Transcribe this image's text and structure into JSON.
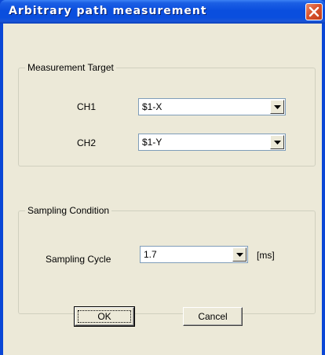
{
  "window": {
    "title": "Arbitrary path measurement"
  },
  "measurement_target": {
    "legend": "Measurement Target",
    "ch1": {
      "label": "CH1",
      "value": "$1-X"
    },
    "ch2": {
      "label": "CH2",
      "value": "$1-Y"
    }
  },
  "sampling_condition": {
    "legend": "Sampling Condition",
    "cycle": {
      "label": "Sampling Cycle",
      "value": "1.7",
      "unit": "[ms]"
    }
  },
  "buttons": {
    "ok": "OK",
    "cancel": "Cancel"
  },
  "colors": {
    "titlebar": "#0a4ede",
    "close": "#d9532d",
    "face": "#ece9d8"
  },
  "icons": {
    "close": "close-icon",
    "dropdown": "chevron-down-icon"
  }
}
